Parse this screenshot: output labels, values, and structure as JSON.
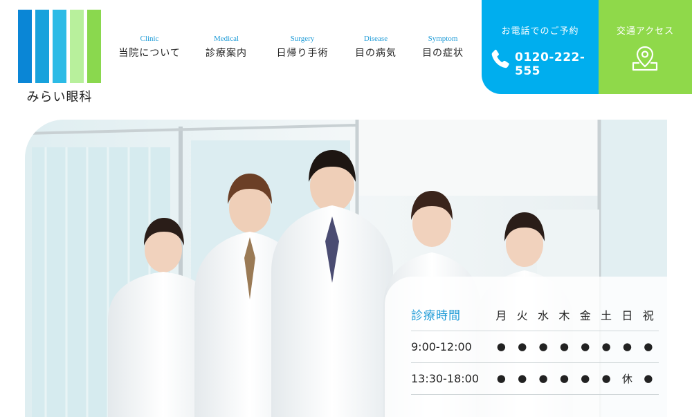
{
  "logo": {
    "name": "みらい眼科",
    "bar_colors": [
      "#0a86d6",
      "#18a2dc",
      "#2cbbe6",
      "#b8f09c",
      "#8ad84e"
    ]
  },
  "nav": [
    {
      "en": "Clinic",
      "ja": "当院について"
    },
    {
      "en": "Medical",
      "ja": "診療案内"
    },
    {
      "en": "Surgery",
      "ja": "日帰り手術"
    },
    {
      "en": "Disease",
      "ja": "目の病気"
    },
    {
      "en": "Symptom",
      "ja": "目の症状"
    }
  ],
  "contact": {
    "tel_label": "お電話でのご予約",
    "tel_number": "0120-222-555",
    "tel_icon": "phone-icon",
    "access_label": "交通アクセス",
    "access_icon": "map-pin-icon",
    "tel_color": "#00aeee",
    "access_color": "#8fd94a"
  },
  "hero": {
    "image_icon": "staff-photo"
  },
  "hours": {
    "title": "診療時間",
    "days": [
      "月",
      "火",
      "水",
      "木",
      "金",
      "土",
      "日",
      "祝"
    ],
    "rows": [
      {
        "time": "9:00-12:00",
        "marks": [
          "●",
          "●",
          "●",
          "●",
          "●",
          "●",
          "●",
          "●"
        ]
      },
      {
        "time": "13:30-18:00",
        "marks": [
          "●",
          "●",
          "●",
          "●",
          "●",
          "●",
          "休",
          "●"
        ]
      }
    ]
  }
}
